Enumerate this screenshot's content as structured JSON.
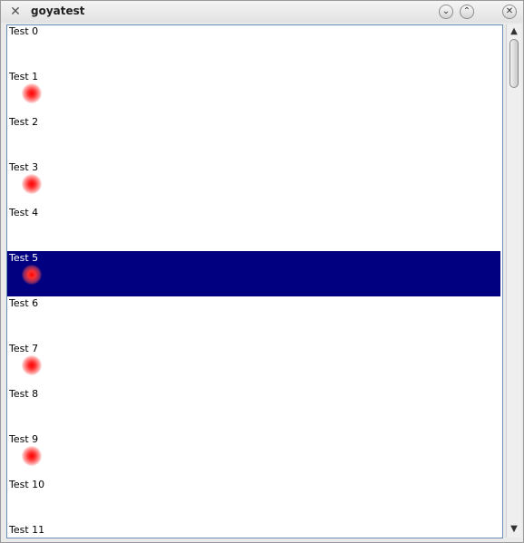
{
  "window": {
    "title": "goyatest",
    "icons": {
      "app": "app-x-icon",
      "minimize": "chevron-down-icon",
      "maximize": "chevron-up-icon",
      "close": "close-icon"
    }
  },
  "list": {
    "items": [
      {
        "label": "Test 0",
        "dot": false,
        "selected": false
      },
      {
        "label": "Test 1",
        "dot": true,
        "selected": false
      },
      {
        "label": "Test 2",
        "dot": false,
        "selected": false
      },
      {
        "label": "Test 3",
        "dot": true,
        "selected": false
      },
      {
        "label": "Test 4",
        "dot": false,
        "selected": false
      },
      {
        "label": "Test 5",
        "dot": true,
        "selected": true
      },
      {
        "label": "Test 6",
        "dot": false,
        "selected": false
      },
      {
        "label": "Test 7",
        "dot": true,
        "selected": false
      },
      {
        "label": "Test 8",
        "dot": false,
        "selected": false
      },
      {
        "label": "Test 9",
        "dot": true,
        "selected": false
      },
      {
        "label": "Test 10",
        "dot": false,
        "selected": false
      },
      {
        "label": "Test 11",
        "dot": false,
        "selected": false
      }
    ],
    "selection_color": "#000080",
    "dot_color": "#ff0000"
  },
  "scrollbar": {
    "position": 0.0
  }
}
